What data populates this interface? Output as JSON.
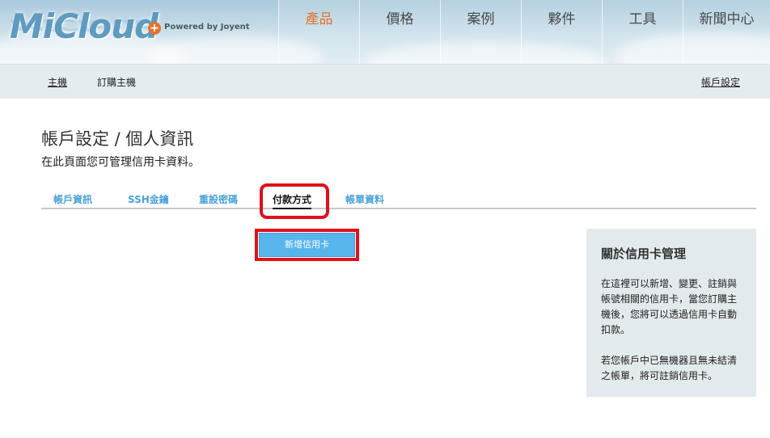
{
  "header": {
    "logo": "MiCloud",
    "logo_plus": "+",
    "powered_by": "Powered by Joyent",
    "nav": [
      {
        "label": "產品",
        "active": true
      },
      {
        "label": "價格",
        "active": false
      },
      {
        "label": "案例",
        "active": false
      },
      {
        "label": "夥件",
        "active": false
      },
      {
        "label": "工具",
        "active": false
      },
      {
        "label": "新聞中心",
        "active": false
      }
    ]
  },
  "subnav": {
    "left": [
      {
        "label": "主機"
      },
      {
        "label": "訂購主機"
      }
    ],
    "right": {
      "label": "帳戶設定"
    }
  },
  "page": {
    "title": "帳戶設定 / 個人資訊",
    "description": "在此頁面您可管理信用卡資料。"
  },
  "tabs": [
    {
      "label": "帳戶資訊",
      "active": false
    },
    {
      "label": "SSH金鑰",
      "active": false
    },
    {
      "label": "重設密碼",
      "active": false
    },
    {
      "label": "付款方式",
      "active": true
    },
    {
      "label": "帳單資料",
      "active": false
    }
  ],
  "actions": {
    "add_card_label": "新增信用卡"
  },
  "side_panel": {
    "title": "關於信用卡管理",
    "paragraphs": [
      "在這裡可以新增、變更、註銷與帳號相關的信用卡，當您訂購主機後，您將可以透過信用卡自動扣款。",
      "若您帳戶中已無機器且無未結清之帳單，將可註銷信用卡。"
    ]
  },
  "colors": {
    "accent_orange": "#e2742e",
    "link_blue": "#4aa3d8",
    "button_blue": "#58b5eb",
    "highlight_red": "#e0101a"
  }
}
